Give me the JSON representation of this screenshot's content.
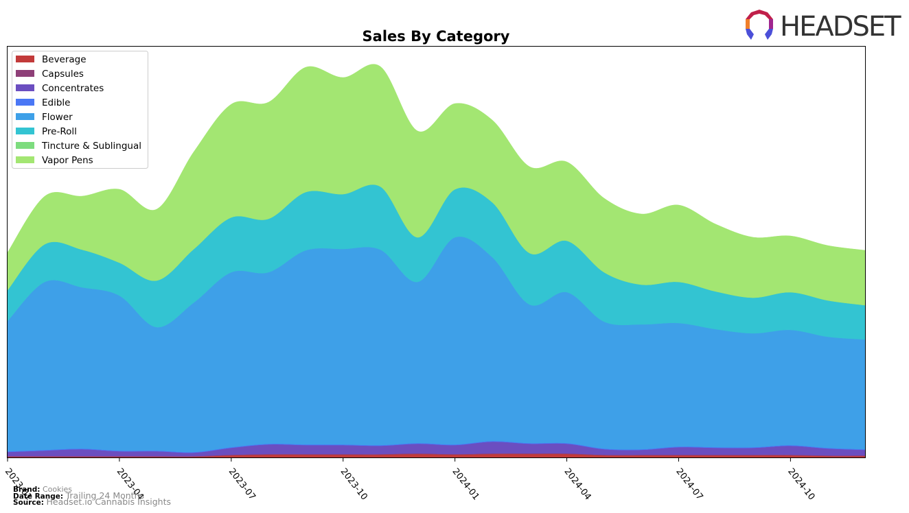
{
  "brand_logo": {
    "text": "HEADSET"
  },
  "footer": {
    "brand_label": "Brand:",
    "brand_value": "Cookies",
    "date_label": "Date Range:",
    "date_value": "Trailing 24 Months",
    "source_label": "Source:",
    "source_value": "Headset.io Cannabis Insights"
  },
  "chart_data": {
    "type": "area",
    "stacked": true,
    "smoothed": true,
    "title": "Sales By Category",
    "xlabel": "",
    "ylabel": "",
    "y_units": "relative sales (no axis labels shown)",
    "ylim": [
      0,
      600
    ],
    "grid": false,
    "legend_position": "top-left",
    "x": [
      "2023-01",
      "2023-02",
      "2023-03",
      "2023-04",
      "2023-05",
      "2023-06",
      "2023-07",
      "2023-08",
      "2023-09",
      "2023-10",
      "2023-11",
      "2023-12",
      "2024-01",
      "2024-02",
      "2024-03",
      "2024-04",
      "2024-05",
      "2024-06",
      "2024-07",
      "2024-08",
      "2024-09",
      "2024-10",
      "2024-11",
      "2024-12"
    ],
    "x_ticks": [
      "2023-01",
      "2023-04",
      "2023-07",
      "2023-10",
      "2024-01",
      "2024-04",
      "2024-07",
      "2024-10"
    ],
    "series": [
      {
        "name": "Beverage",
        "color": "#c23a3a",
        "values": [
          1,
          1,
          1,
          1,
          1,
          1,
          3,
          4,
          4,
          4,
          4,
          5,
          4,
          5,
          5,
          5,
          3,
          3,
          3,
          3,
          3,
          3,
          2,
          2
        ]
      },
      {
        "name": "Capsules",
        "color": "#8e3f78",
        "values": [
          1,
          1,
          1,
          1,
          1,
          1,
          1,
          1,
          1,
          1,
          1,
          1,
          1,
          1,
          1,
          1,
          1,
          1,
          1,
          1,
          1,
          1,
          1,
          1
        ]
      },
      {
        "name": "Concentrates",
        "color": "#6b4ec0",
        "values": [
          6,
          8,
          10,
          7,
          7,
          5,
          10,
          14,
          13,
          13,
          12,
          14,
          13,
          17,
          14,
          14,
          8,
          7,
          11,
          10,
          10,
          13,
          10,
          8
        ]
      },
      {
        "name": "Edible",
        "color": "#4a77f5",
        "values": [
          1,
          1,
          1,
          1,
          1,
          1,
          1,
          1,
          1,
          1,
          1,
          1,
          1,
          1,
          1,
          1,
          1,
          1,
          1,
          1,
          1,
          1,
          1,
          1
        ]
      },
      {
        "name": "Flower",
        "color": "#3ea0e8",
        "values": [
          190,
          245,
          235,
          226,
          180,
          218,
          255,
          250,
          283,
          285,
          285,
          235,
          302,
          268,
          202,
          220,
          185,
          182,
          180,
          172,
          166,
          168,
          162,
          160
        ]
      },
      {
        "name": "Pre-Roll",
        "color": "#33c4d2",
        "values": [
          45,
          55,
          55,
          48,
          68,
          78,
          80,
          78,
          85,
          80,
          92,
          65,
          70,
          80,
          75,
          75,
          72,
          58,
          60,
          55,
          52,
          55,
          53,
          50
        ]
      },
      {
        "name": "Tincture & Sublingual",
        "color": "#7ddc7e",
        "values": [
          0,
          0,
          0,
          0,
          0,
          0,
          0,
          0,
          0,
          0,
          0,
          0,
          0,
          0,
          0,
          0,
          0,
          0,
          0,
          0,
          0,
          0,
          0,
          0
        ]
      },
      {
        "name": "Vapor Pens",
        "color": "#a3e672",
        "values": [
          55,
          70,
          78,
          107,
          104,
          142,
          165,
          170,
          182,
          170,
          175,
          155,
          125,
          120,
          126,
          115,
          108,
          103,
          112,
          98,
          88,
          82,
          80,
          80
        ]
      }
    ]
  }
}
